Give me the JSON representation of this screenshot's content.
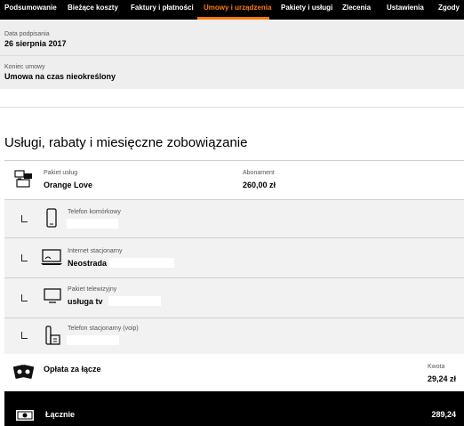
{
  "nav": {
    "items": [
      {
        "label": "Podsumowanie"
      },
      {
        "label": "Bieżące koszty"
      },
      {
        "label": "Faktury i płatności"
      },
      {
        "label": "Umowy i urządzenia"
      },
      {
        "label": "Pakiety i usługi"
      },
      {
        "label": "Zlecenia"
      },
      {
        "label": "Ustawienia"
      },
      {
        "label": "Zgody"
      }
    ],
    "active": "Umowy i urządzenia",
    "accent_color": "#ff7900"
  },
  "contract": {
    "signed_label": "Data podpisania",
    "signed_value": "26 sierpnia 2017",
    "end_label": "Koniec umowy",
    "end_value": "Umowa na czas nieokreślony"
  },
  "services": {
    "title": "Usługi, rabaty i miesięczne zobowiązanie",
    "package": {
      "icon": "tv-monitor-icon",
      "label": "Pakiet usług",
      "value": "Orange Love",
      "fee_label": "Abonament",
      "fee_value": "260,00 zł"
    },
    "items": [
      {
        "icon": "mobile-phone-icon",
        "label": "Telefon komórkowy",
        "value": ""
      },
      {
        "icon": "laptop-icon",
        "label": "Internet stacjonarny",
        "value": "Neostrada"
      },
      {
        "icon": "tv-icon",
        "label": "Pakiet telewizyjny",
        "value": "usługa tv"
      },
      {
        "icon": "landline-phone-icon",
        "label": "Telefon stacjonarny (voip)",
        "value": ""
      }
    ],
    "connection": {
      "icon": "money-cards-icon",
      "label": "Opłata za łącze",
      "amount_label": "Kwota",
      "amount_value": "29,24 zł"
    },
    "total": {
      "icon": "banknote-icon",
      "label": "Łącznie",
      "value": "289,24"
    }
  }
}
